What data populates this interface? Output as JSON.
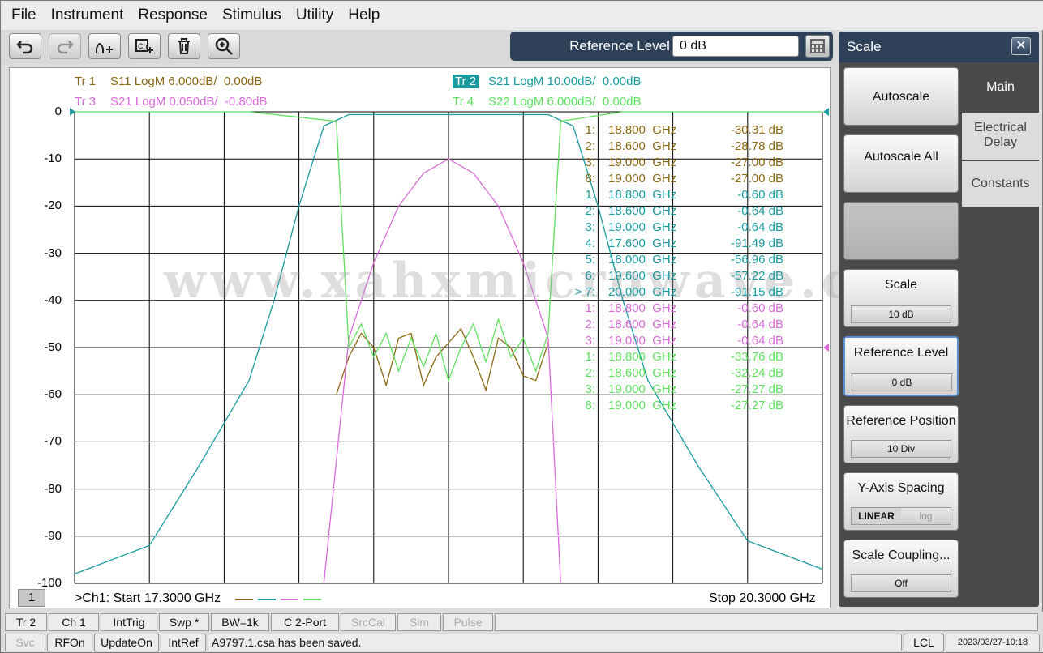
{
  "menu": [
    "File",
    "Instrument",
    "Response",
    "Stimulus",
    "Utility",
    "Help"
  ],
  "toolbar_icons": [
    "undo-icon",
    "redo-icon",
    "add-trace-icon",
    "add-channel-icon",
    "delete-icon",
    "zoom-icon"
  ],
  "reference_level": {
    "label": "Reference Level",
    "value": "0 dB"
  },
  "traces": [
    {
      "id": "Tr 1",
      "desc": "S11 LogM 6.000dB/  0.00dB",
      "color": "#8b6914"
    },
    {
      "id": "Tr 2",
      "desc": "S21 LogM 10.00dB/  0.00dB",
      "color": "#1a9ba0",
      "active": true
    },
    {
      "id": "Tr 3",
      "desc": "S21 LogM 0.050dB/  -0.80dB",
      "color": "#d86ad8"
    },
    {
      "id": "Tr 4",
      "desc": "S22 LogM 6.000dB/  0.00dB",
      "color": "#5ee05e"
    }
  ],
  "y_axis": [
    "0",
    "-10",
    "-20",
    "-30",
    "-40",
    "-50",
    "-60",
    "-70",
    "-80",
    "-90",
    "-100"
  ],
  "markers": [
    {
      "idx": "1:",
      "freq": "18.800  GHz",
      "val": "-30.31 dB",
      "color": "#8b6914"
    },
    {
      "idx": "2:",
      "freq": "18.600  GHz",
      "val": "-28.78 dB",
      "color": "#8b6914"
    },
    {
      "idx": "3:",
      "freq": "19.000  GHz",
      "val": "-27.00 dB",
      "color": "#8b6914"
    },
    {
      "idx": "8:",
      "freq": "19.000  GHz",
      "val": "-27.00 dB",
      "color": "#8b6914"
    },
    {
      "idx": "1:",
      "freq": "18.800  GHz",
      "val": "-0.60 dB",
      "color": "#1a9ba0"
    },
    {
      "idx": "2:",
      "freq": "18.600  GHz",
      "val": "-0.64 dB",
      "color": "#1a9ba0"
    },
    {
      "idx": "3:",
      "freq": "19.000  GHz",
      "val": "-0.64 dB",
      "color": "#1a9ba0"
    },
    {
      "idx": "4:",
      "freq": "17.600  GHz",
      "val": "-91.49 dB",
      "color": "#1a9ba0"
    },
    {
      "idx": "5:",
      "freq": "18.000  GHz",
      "val": "-56.96 dB",
      "color": "#1a9ba0"
    },
    {
      "idx": "6:",
      "freq": "19.600  GHz",
      "val": "-57.22 dB",
      "color": "#1a9ba0"
    },
    {
      "idx": "> 7:",
      "freq": "20.000  GHz",
      "val": "-91.15 dB",
      "color": "#1a9ba0"
    },
    {
      "idx": "1:",
      "freq": "18.800  GHz",
      "val": "-0.60 dB",
      "color": "#d86ad8"
    },
    {
      "idx": "2:",
      "freq": "18.600  GHz",
      "val": "-0.64 dB",
      "color": "#d86ad8"
    },
    {
      "idx": "3:",
      "freq": "19.000  GHz",
      "val": "-0.64 dB",
      "color": "#d86ad8"
    },
    {
      "idx": "1:",
      "freq": "18.800  GHz",
      "val": "-33.76 dB",
      "color": "#5ee05e"
    },
    {
      "idx": "2:",
      "freq": "18.600  GHz",
      "val": "-32.24 dB",
      "color": "#5ee05e"
    },
    {
      "idx": "3:",
      "freq": "19.000  GHz",
      "val": "-27.27 dB",
      "color": "#5ee05e"
    },
    {
      "idx": "8:",
      "freq": "19.000  GHz",
      "val": "-27.27 dB",
      "color": "#5ee05e"
    }
  ],
  "watermark": "www.xahxmicrowave.com",
  "channel_badge": "1",
  "start": ">Ch1:  Start   17.3000 GHz",
  "stop": "Stop  20.3000 GHz",
  "side_panel": {
    "title": "Scale",
    "tabs": [
      "Main",
      "Electrical Delay",
      "Constants"
    ],
    "buttons": {
      "autoscale": "Autoscale",
      "autoscale_all": "Autoscale All",
      "scale": {
        "label": "Scale",
        "value": "10 dB"
      },
      "reference_level": {
        "label": "Reference Level",
        "value": "0 dB"
      },
      "reference_position": {
        "label": "Reference Position",
        "value": "10 Div"
      },
      "y_axis_spacing": {
        "label": "Y-Axis Spacing",
        "linear": "LINEAR",
        "log": "log"
      },
      "scale_coupling": {
        "label": "Scale Coupling...",
        "value": "Off"
      }
    }
  },
  "status_row1": [
    "Tr 2",
    "Ch 1",
    "IntTrig",
    "Swp *",
    "BW=1k",
    "C  2-Port",
    "SrcCal",
    "Sim",
    "Pulse"
  ],
  "status_row2": [
    "Svc",
    "RFOn",
    "UpdateOn",
    "IntRef",
    "A9797.1.csa has been saved.",
    "LCL",
    "2023/03/27-10:18"
  ],
  "chart_data": {
    "type": "line",
    "xlabel": "",
    "ylabel": "",
    "xlim": [
      17.3,
      20.3
    ],
    "ylim": [
      -100,
      0
    ],
    "grid": true,
    "series": [
      {
        "name": "S11",
        "points": [
          [
            18.35,
            -60
          ],
          [
            18.4,
            -52
          ],
          [
            18.45,
            -47
          ],
          [
            18.5,
            -50
          ],
          [
            18.55,
            -58
          ],
          [
            18.6,
            -48
          ],
          [
            18.65,
            -47
          ],
          [
            18.7,
            -58
          ],
          [
            18.75,
            -52
          ],
          [
            18.8,
            -49
          ],
          [
            18.85,
            -46
          ],
          [
            18.9,
            -52
          ],
          [
            18.95,
            -59
          ],
          [
            19.0,
            -48
          ],
          [
            19.05,
            -50
          ],
          [
            19.1,
            -56
          ],
          [
            19.15,
            -57
          ],
          [
            19.2,
            -49
          ]
        ]
      },
      {
        "name": "S21",
        "points": [
          [
            17.3,
            -98
          ],
          [
            17.6,
            -92
          ],
          [
            17.8,
            -75
          ],
          [
            18.0,
            -57
          ],
          [
            18.1,
            -40
          ],
          [
            18.2,
            -20
          ],
          [
            18.3,
            -3
          ],
          [
            18.4,
            -0.6
          ],
          [
            18.6,
            -0.6
          ],
          [
            18.8,
            -0.6
          ],
          [
            19.0,
            -0.6
          ],
          [
            19.2,
            -0.6
          ],
          [
            19.3,
            -3
          ],
          [
            19.4,
            -20
          ],
          [
            19.5,
            -40
          ],
          [
            19.6,
            -57
          ],
          [
            19.8,
            -75
          ],
          [
            20.0,
            -91
          ],
          [
            20.3,
            -97
          ]
        ]
      },
      {
        "name": "S21",
        "points": [
          [
            18.3,
            -100
          ],
          [
            18.4,
            -48
          ],
          [
            18.5,
            -32
          ],
          [
            18.6,
            -20
          ],
          [
            18.7,
            -13
          ],
          [
            18.8,
            -10
          ],
          [
            18.9,
            -13
          ],
          [
            19.0,
            -20
          ],
          [
            19.1,
            -32
          ],
          [
            19.2,
            -48
          ],
          [
            19.25,
            -100
          ]
        ]
      },
      {
        "name": "S22",
        "points": [
          [
            17.3,
            0
          ],
          [
            18.0,
            0
          ],
          [
            18.35,
            -2
          ],
          [
            18.4,
            -50
          ],
          [
            18.45,
            -45
          ],
          [
            18.5,
            -52
          ],
          [
            18.55,
            -47
          ],
          [
            18.6,
            -55
          ],
          [
            18.65,
            -48
          ],
          [
            18.7,
            -54
          ],
          [
            18.75,
            -47
          ],
          [
            18.8,
            -57
          ],
          [
            18.85,
            -50
          ],
          [
            18.9,
            -45
          ],
          [
            18.95,
            -53
          ],
          [
            19.0,
            -44
          ],
          [
            19.05,
            -52
          ],
          [
            19.1,
            -48
          ],
          [
            19.15,
            -55
          ],
          [
            19.2,
            -47
          ],
          [
            19.25,
            -2
          ],
          [
            19.5,
            0
          ],
          [
            20.3,
            0
          ]
        ]
      }
    ]
  }
}
